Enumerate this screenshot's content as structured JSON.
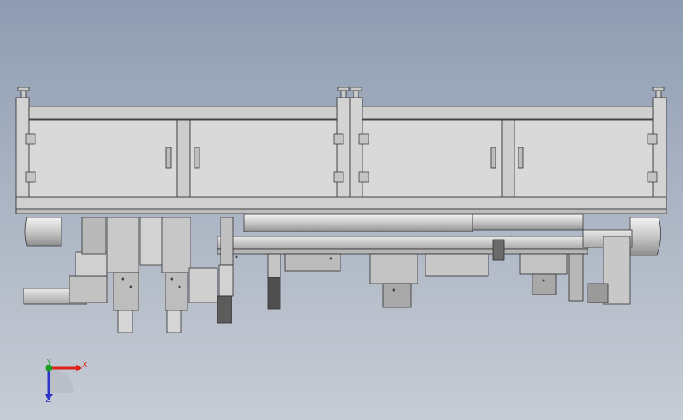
{
  "viewport": {
    "background_top": "#8e9cb2",
    "background_bottom": "#c7ccd5"
  },
  "model": {
    "frame_color": "#d3d3d3",
    "panel_color": "#d9d9d9",
    "edge_color": "#3a3a3a",
    "cabinet_doors": 4,
    "leveling_feet": 4
  },
  "triad": {
    "x_label": "X",
    "y_label": "Y",
    "z_label": "Z",
    "x_color": "#e0201a",
    "y_color": "#1f9c22",
    "z_color": "#2a35c8"
  }
}
